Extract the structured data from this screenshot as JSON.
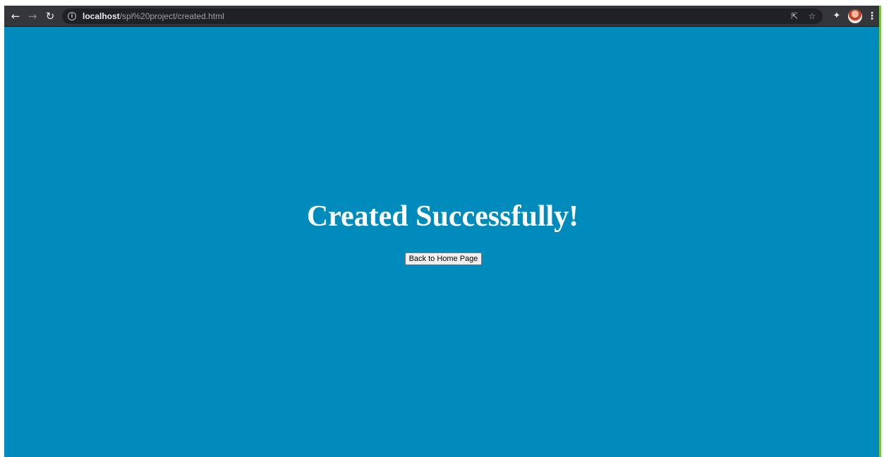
{
  "browser": {
    "url_host": "localhost",
    "url_path": "/spl%20project/created.html",
    "icons": {
      "back": "back-arrow-icon",
      "forward": "forward-arrow-icon",
      "reload": "reload-icon",
      "site_info": "info-icon",
      "share": "share-icon",
      "bookmark": "star-icon",
      "extensions": "puzzle-icon",
      "profile": "avatar",
      "menu": "kebab-menu-icon"
    }
  },
  "page": {
    "heading": "Created Successfully!",
    "home_button_label": "Back to Home Page",
    "background_color": "#008bbd",
    "heading_color": "#ffffff"
  }
}
